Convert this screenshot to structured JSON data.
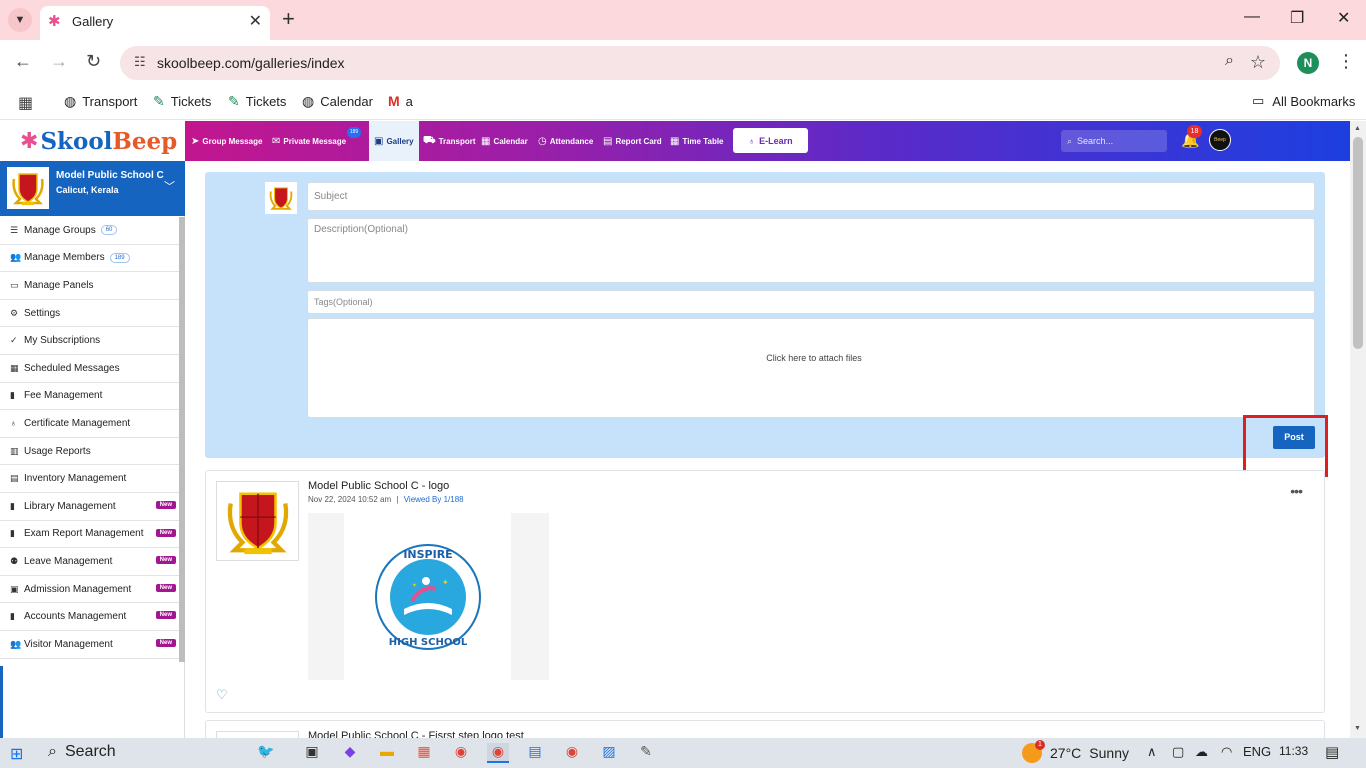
{
  "browser": {
    "tab_title": "Gallery",
    "url": "skoolbeep.com/galleries/index",
    "profile_initial": "N",
    "bookmarks": [
      {
        "label": "Transport",
        "icon": "globe-icon"
      },
      {
        "label": "Tickets",
        "icon": "ticket-icon"
      },
      {
        "label": "Tickets",
        "icon": "ticket-icon"
      },
      {
        "label": "Calendar",
        "icon": "globe-icon"
      },
      {
        "label": "a",
        "icon": "gmail-icon"
      }
    ],
    "all_bookmarks": "All Bookmarks"
  },
  "brand": {
    "skool": "Skool",
    "beep": "Beep",
    "accent": "#1565c0",
    "pink": "#c2168f"
  },
  "nav": {
    "items": [
      {
        "label": "Group Message",
        "icon": "send-icon"
      },
      {
        "label": "Private Message",
        "icon": "mail-icon"
      },
      {
        "label": "Gallery",
        "icon": "image-icon"
      },
      {
        "label": "Transport",
        "icon": "bus-icon"
      },
      {
        "label": "Calendar",
        "icon": "calendar-icon"
      },
      {
        "label": "Attendance",
        "icon": "clock-icon"
      },
      {
        "label": "Report Card",
        "icon": "card-icon"
      },
      {
        "label": "Time Table",
        "icon": "calendar-icon"
      }
    ],
    "private_badge": "189",
    "elearn": "E-Learn",
    "search_placeholder": "Search...",
    "notification_count": "18",
    "avatar_text": "Beep"
  },
  "school": {
    "name": "Model Public School C",
    "location": "Calicut, Kerala"
  },
  "sidebar": {
    "items": [
      {
        "label": "Manage Groups",
        "icon": "list-icon",
        "count": "60",
        "new": ""
      },
      {
        "label": "Manage Members",
        "icon": "users-icon",
        "count": "189",
        "new": ""
      },
      {
        "label": "Manage Panels",
        "icon": "monitor-icon",
        "count": "",
        "new": ""
      },
      {
        "label": "Settings",
        "icon": "gear-icon",
        "count": "",
        "new": ""
      },
      {
        "label": "My Subscriptions",
        "icon": "check-icon",
        "count": "",
        "new": ""
      },
      {
        "label": "Scheduled Messages",
        "icon": "calendar-icon",
        "count": "",
        "new": ""
      },
      {
        "label": "Fee Management",
        "icon": "file-icon",
        "count": "",
        "new": ""
      },
      {
        "label": "Certificate Management",
        "icon": "award-icon",
        "count": "",
        "new": ""
      },
      {
        "label": "Usage Reports",
        "icon": "bar-chart-icon",
        "count": "",
        "new": ""
      },
      {
        "label": "Inventory Management",
        "icon": "box-icon",
        "count": "",
        "new": ""
      },
      {
        "label": "Library Management",
        "icon": "book-icon",
        "count": "",
        "new": "New"
      },
      {
        "label": "Exam Report Management",
        "icon": "file-icon",
        "count": "",
        "new": "New"
      },
      {
        "label": "Leave Management",
        "icon": "user-x-icon",
        "count": "",
        "new": "New"
      },
      {
        "label": "Admission Management",
        "icon": "id-card-icon",
        "count": "",
        "new": "New"
      },
      {
        "label": "Accounts Management",
        "icon": "file-icon",
        "count": "",
        "new": "New"
      },
      {
        "label": "Visitor Management",
        "icon": "users-icon",
        "count": "",
        "new": "New"
      }
    ]
  },
  "composer": {
    "subject_placeholder": "Subject",
    "description_placeholder": "Description(Optional)",
    "tags_placeholder": "Tags(Optional)",
    "attach_text": "Click here to attach files",
    "post_label": "Post"
  },
  "posts": [
    {
      "title": "Model Public School C - logo",
      "date": "Nov 22, 2024 10:52 am",
      "separator": "|",
      "viewed": "Viewed By 1/188",
      "image_text_top": "INSPIRE",
      "image_text_bottom": "HIGH SCHOOL"
    },
    {
      "title": "Model Public School C - Fisrst step logo test"
    }
  ],
  "taskbar": {
    "search_label": "Search",
    "weather_temp": "27°C",
    "weather_desc": "Sunny",
    "weather_badge": "1",
    "language": "ENG",
    "time": "11:33"
  }
}
